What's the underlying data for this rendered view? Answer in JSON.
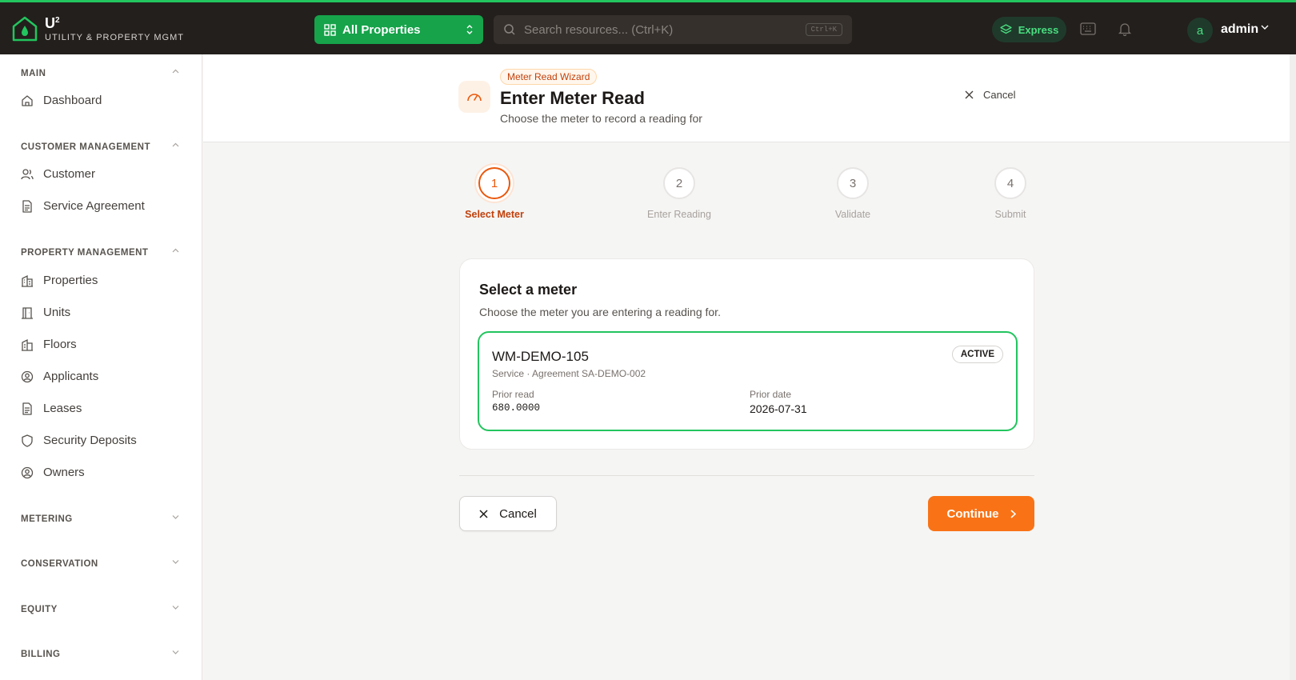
{
  "brand": {
    "logo": "U",
    "logo_sup": "2",
    "subtitle": "UTILITY & PROPERTY MGMT"
  },
  "topbar": {
    "property_select": "All Properties",
    "search_placeholder": "Search resources... (Ctrl+K)",
    "search_shortcut": "Ctrl+K",
    "express_label": "Express",
    "avatar_initial": "a",
    "user_name": "admin"
  },
  "sidebar": {
    "main": {
      "title": "MAIN",
      "items": [
        "Dashboard"
      ]
    },
    "customer": {
      "title": "CUSTOMER MANAGEMENT",
      "items": [
        "Customer",
        "Service Agreement"
      ]
    },
    "property": {
      "title": "PROPERTY MANAGEMENT",
      "items": [
        "Properties",
        "Units",
        "Floors",
        "Applicants",
        "Leases",
        "Security Deposits",
        "Owners"
      ]
    },
    "collapsed": [
      "METERING",
      "CONSERVATION",
      "EQUITY",
      "BILLING"
    ]
  },
  "header": {
    "badge": "Meter Read Wizard",
    "title": "Enter Meter Read",
    "subtitle": "Choose the meter to record a reading for",
    "cancel": "Cancel"
  },
  "steps": [
    {
      "num": "1",
      "label": "Select Meter",
      "active": true
    },
    {
      "num": "2",
      "label": "Enter Reading",
      "active": false
    },
    {
      "num": "3",
      "label": "Validate",
      "active": false
    },
    {
      "num": "4",
      "label": "Submit",
      "active": false
    }
  ],
  "card": {
    "title": "Select a meter",
    "subtitle": "Choose the meter you are entering a reading for.",
    "meter": {
      "id": "WM-DEMO-105",
      "agreement": "Service · Agreement SA-DEMO-002",
      "status": "ACTIVE",
      "prior_read_label": "Prior read",
      "prior_read": "680.0000",
      "prior_date_label": "Prior date",
      "prior_date": "2026-07-31"
    }
  },
  "actions": {
    "cancel": "Cancel",
    "continue": "Continue"
  },
  "colors": {
    "accent": "#f97316",
    "brand_green": "#22c55e",
    "topbar": "#231f1c"
  }
}
